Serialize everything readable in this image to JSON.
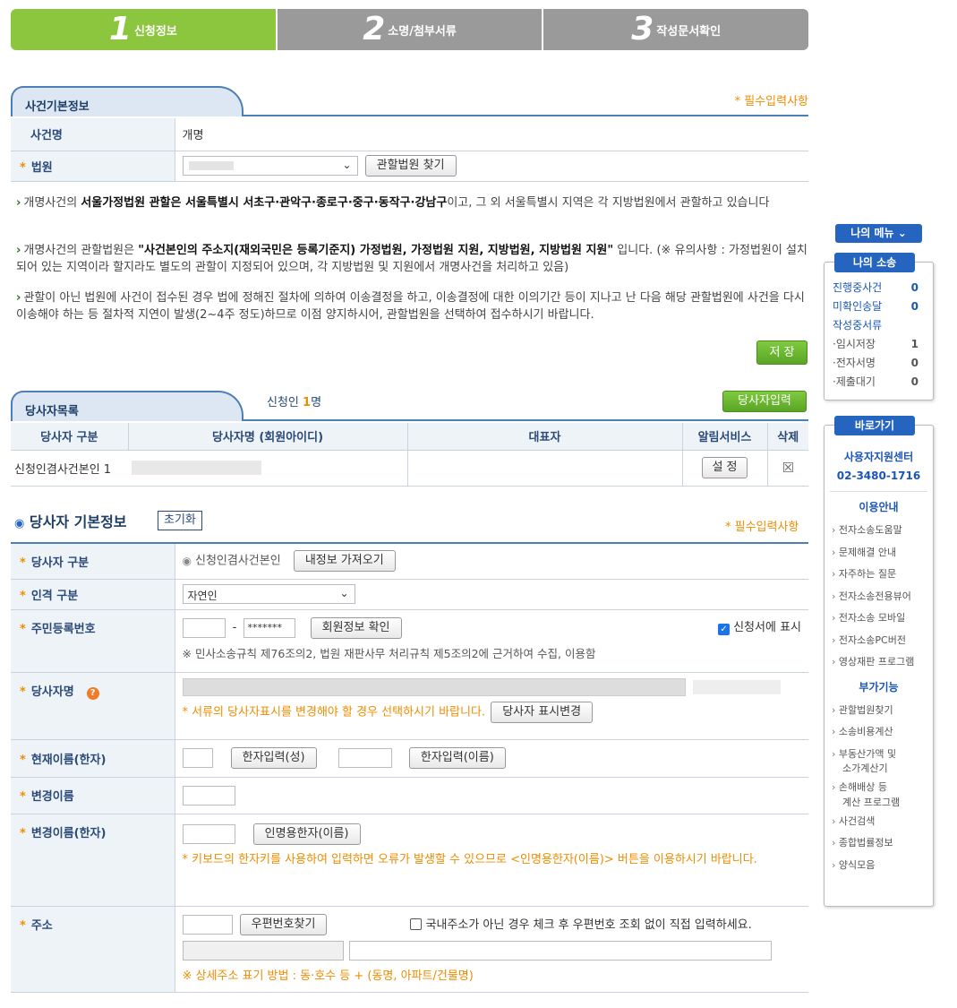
{
  "steps": [
    {
      "num": "1",
      "label": "신청정보"
    },
    {
      "num": "2",
      "label": "소명/첨부서류"
    },
    {
      "num": "3",
      "label": "작성문서확인"
    }
  ],
  "case_section": {
    "title": "사건기본정보",
    "required_note": "* 필수입력사항",
    "case_name_label": "사건명",
    "case_name_value": "개명",
    "court_label": "법원",
    "find_court_button": "관할법원 찾기"
  },
  "notices": [
    {
      "pre": "개명사건의 ",
      "bold": "서울가정법원 관할은 서울특별시 서초구·관악구·종로구·중구·동작구·강남구",
      "post": "이고, 그 외 서울특별시 지역은 각 지방법원에서 관할하고 있습니다"
    },
    {
      "pre": "개명사건의 관할법원은 ",
      "bold": "\"사건본인의 주소지(재외국민은 등록기준지) 가정법원, 가정법원 지원, 지방법원, 지방법원 지원\"",
      "post": " 입니다. (※ 유의사항 : 가정법원이 설치되어 있는 지역이라 할지라도 별도의 관할이 지정되어 있으며, 각 지방법원 및 지원에서 개명사건을 처리하고 있음)"
    },
    {
      "pre": "관할이 아닌 법원에 사건이 접수된 경우 법에 정해진 절차에 의하여 이송결정을 하고, 이송결정에 대한 이의기간 등이 지나고 난 다음 해당 관할법원에 사건을 다시 이송해야 하는 등 절차적 지연이 발생(2~4주 정도)하므로 이점 양지하시어, 관할법원을 선택하여 접수하시기 바랍니다.",
      "bold": "",
      "post": ""
    }
  ],
  "save_button": "저 장",
  "party_list": {
    "title": "당사자목록",
    "applicant_label": "신청인",
    "applicant_count": "1",
    "applicant_unit": "명",
    "add_button": "당사자입력",
    "headers": [
      "당사자 구분",
      "당사자명 (회원아이디)",
      "대표자",
      "알림서비스",
      "삭제"
    ],
    "row": {
      "type": "신청인겸사건본인 1",
      "notify_button": "설 정",
      "delete_icon": "☒"
    }
  },
  "party_basic": {
    "title": "당사자 기본정보",
    "reset_button": "초기화",
    "required_note": "* 필수입력사항",
    "type_label": "당사자 구분",
    "type_value": "신청인겸사건본인",
    "import_button": "내정보 가져오기",
    "person_label": "인격 구분",
    "person_value": "자연인",
    "rrn_label": "주민등록번호",
    "rrn_mask": "*******",
    "rrn_dash": "-",
    "verify_button": "회원정보 확인",
    "show_on_app": "신청서에 표시",
    "rrn_note": "※ 민사소송규칙 제76조의2, 법원 재판사무 처리규칙 제5조의2에 근거하여 수집, 이용함",
    "name_label": "당사자명",
    "name_note": "* 서류의 당사자표시를 변경해야 할 경우 선택하시기 바랍니다.",
    "name_change_button": "당사자 표시변경",
    "hanja_label": "현재이름(한자)",
    "hanja_surname_button": "한자입력(성)",
    "hanja_name_button": "한자입력(이름)",
    "newname_label": "변경이름",
    "newname_hanja_label": "변경이름(한자)",
    "person_hanja_button": "인명용한자(이름)",
    "hanja_note": "* 키보드의 한자키를 사용하여 입력하면 오류가 발생할 수 있으므로 <인명용한자(이름)> 버튼을 이용하시기 바랍니다.",
    "address_label": "주소",
    "zip_button": "우편번호찾기",
    "foreign_addr": "국내주소가 아닌 경우 체크 후 우편번호 조회 없이 직접 입력하세요.",
    "address_note": "※ 상세주소 표기 방법 : 동·호수 등 + (동명, 아파트/건물명)"
  },
  "sidebar": {
    "my_menu": "나의 메뉴 ⌄",
    "my_case_title": "나의 소송",
    "case_stats": [
      {
        "label": "진행중사건",
        "value": "0",
        "style": "blue"
      },
      {
        "label": "미확인송달",
        "value": "0",
        "style": "blue"
      },
      {
        "label": "작성중서류",
        "value": "",
        "style": "blue"
      },
      {
        "label": "·임시저장",
        "value": "1",
        "style": "gray"
      },
      {
        "label": "·전자서명",
        "value": "0",
        "style": "gray"
      },
      {
        "label": "·제출대기",
        "value": "0",
        "style": "gray"
      }
    ],
    "shortcut_title": "바로가기",
    "support_center": "사용자지원센터",
    "support_phone": "02-3480-1716",
    "usage_title": "이용안내",
    "usage_links": [
      "전자소송도움말",
      "문제해결 안내",
      "자주하는 질문",
      "전자소송전용뷰어",
      "전자소송 모바일",
      "전자소송PC버전",
      "영상재판 프로그램"
    ],
    "extra_title": "부가기능",
    "extra_links": [
      "관할법원찾기",
      "소송비용계산",
      "부동산가액 및\n소가계산기",
      "손해배상 등\n계산 프로그램",
      "사건검색",
      "종합법률정보",
      "양식모음"
    ]
  }
}
